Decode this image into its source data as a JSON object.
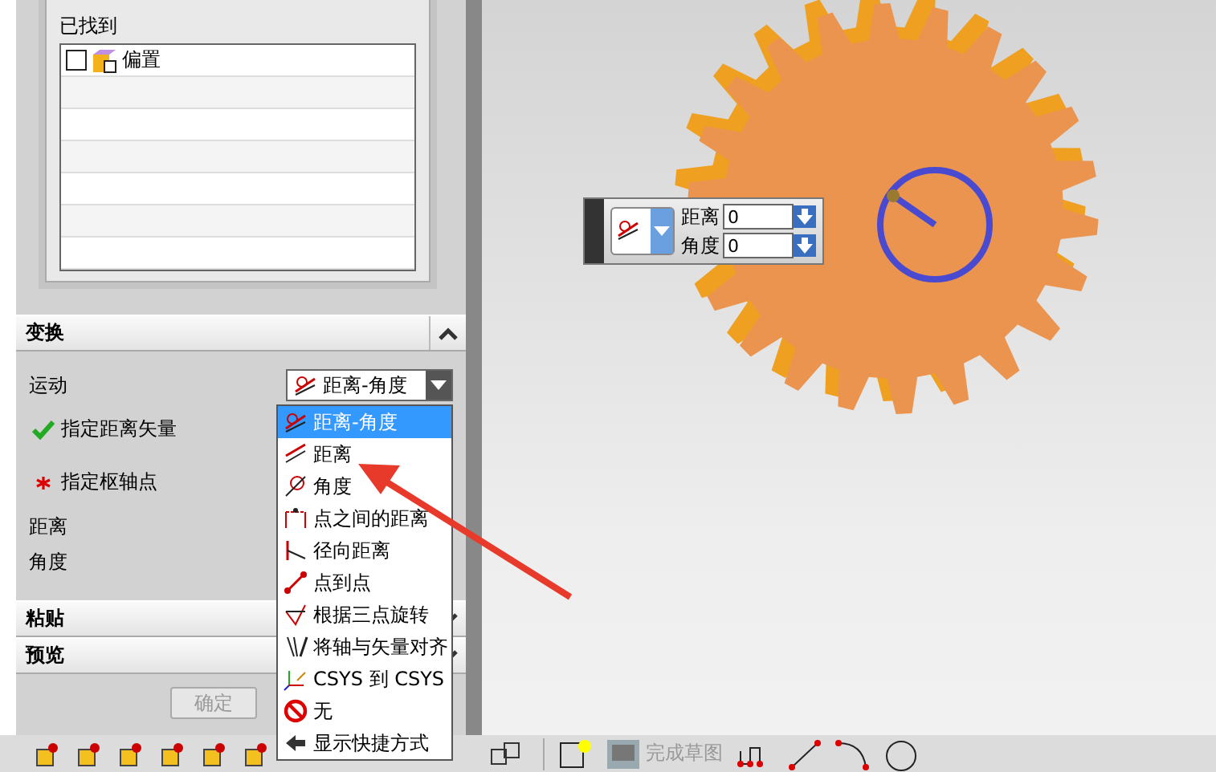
{
  "dialog": {
    "found_label": "已找到",
    "found_list": [
      {
        "label": "偏置",
        "checked": false
      }
    ],
    "transform": {
      "title": "变换",
      "expanded": true,
      "fields": [
        {
          "kind": "dropdown",
          "label": "运动",
          "value": "距离-角度"
        },
        {
          "kind": "selection",
          "label": "指定距离矢量",
          "complete": true
        },
        {
          "kind": "selection",
          "label": "指定枢轴点",
          "complete": false
        },
        {
          "kind": "text",
          "label": "距离"
        },
        {
          "kind": "text",
          "label": "角度"
        }
      ]
    },
    "sections": [
      {
        "title": "粘贴",
        "expanded": false
      },
      {
        "title": "预览",
        "expanded": false
      }
    ],
    "buttons": [
      {
        "label": "确定",
        "disabled": true
      }
    ]
  },
  "dropdown_menu": [
    {
      "label": "距离-角度",
      "selected": true
    },
    {
      "label": "距离",
      "selected": false
    },
    {
      "label": "角度",
      "selected": false
    },
    {
      "label": "点之间的距离",
      "selected": false
    },
    {
      "label": "径向距离",
      "selected": false
    },
    {
      "label": "点到点",
      "selected": false
    },
    {
      "label": "根据三点旋转",
      "selected": false
    },
    {
      "label": "将轴与矢量对齐",
      "selected": false
    },
    {
      "label": "CSYS 到 CSYS",
      "selected": false
    },
    {
      "label": "无",
      "selected": false
    },
    {
      "label": "显示快捷方式",
      "selected": false
    }
  ],
  "inline_widget": {
    "fields": [
      {
        "label": "距离",
        "value": "0"
      },
      {
        "label": "角度",
        "value": "0"
      }
    ]
  },
  "toolbar": {
    "finish_sketch": {
      "label": "完成草图",
      "disabled": true
    }
  }
}
